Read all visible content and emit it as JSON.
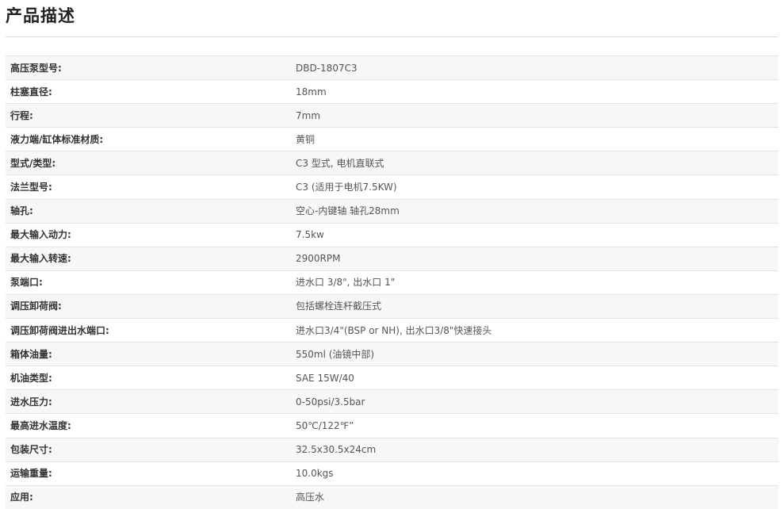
{
  "header": {
    "title": "产品描述"
  },
  "specs": [
    {
      "label": "高压泵型号:",
      "value": "DBD-1807C3"
    },
    {
      "label": "柱塞直径:",
      "value": "18mm"
    },
    {
      "label": "行程:",
      "value": "7mm"
    },
    {
      "label": "液力端/缸体标准材质:",
      "value": "黄铜"
    },
    {
      "label": "型式/类型:",
      "value": "C3 型式, 电机直联式"
    },
    {
      "label": "法兰型号:",
      "value": "C3 (适用于电机7.5KW)"
    },
    {
      "label": "轴孔:",
      "value": "空心-内键轴  轴孔28mm"
    },
    {
      "label": "最大输入动力:",
      "value": "7.5kw"
    },
    {
      "label": "最大输入转速:",
      "value": "2900RPM"
    },
    {
      "label": "泵端口:",
      "value": "进水口 3/8\", 出水口 1\""
    },
    {
      "label": "调压卸荷阀:",
      "value": "包括螺栓连杆截压式"
    },
    {
      "label": "调压卸荷阀进出水端口:",
      "value": "进水口3/4\"(BSP or NH), 出水口3/8\"快速接头"
    },
    {
      "label": "箱体油量:",
      "value": "550ml (油镜中部)"
    },
    {
      "label": "机油类型:",
      "value": "SAE 15W/40"
    },
    {
      "label": "进水压力:",
      "value": "0-50psi/3.5bar"
    },
    {
      "label": "最高进水温度:",
      "value": "50℃/122℉”"
    },
    {
      "label": "包装尺寸:",
      "value": "32.5x30.5x24cm"
    },
    {
      "label": "运输重量:",
      "value": "10.0kgs"
    },
    {
      "label": "应用:",
      "value": "高压水"
    }
  ]
}
